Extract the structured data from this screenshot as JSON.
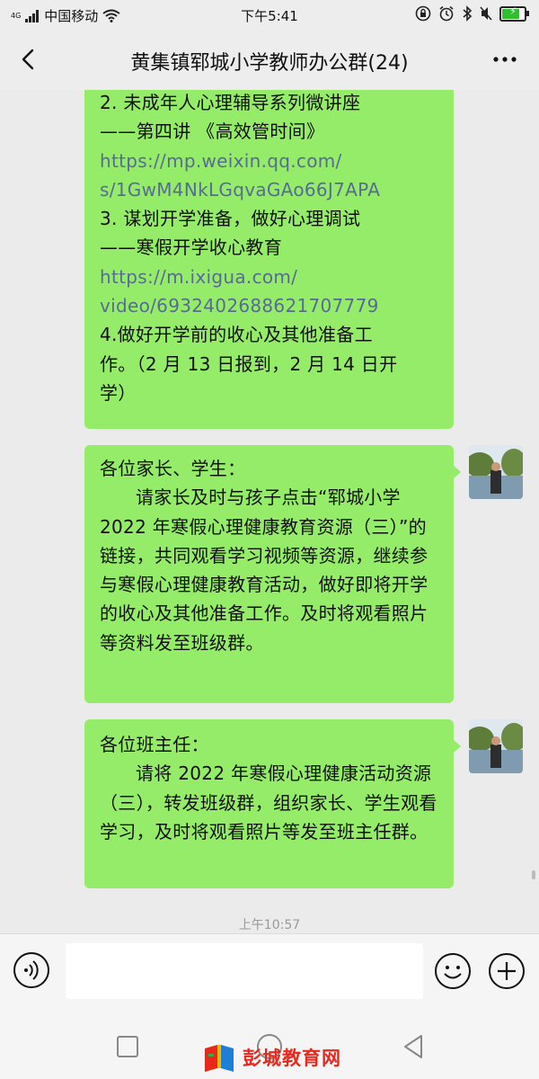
{
  "status_bar": {
    "network": "4G",
    "carrier": "中国移动",
    "time": "下午5:41",
    "battery_level": 0.85
  },
  "header": {
    "title": "黄集镇郓城小学教师办公群(24)"
  },
  "messages": [
    {
      "lines": [
        {
          "type": "text",
          "text": "2. 未成年人心理辅导系列微讲座"
        },
        {
          "type": "text",
          "text": "——第四讲 《高效管时间》"
        },
        {
          "type": "link",
          "text": "https://mp.weixin.qq.com/"
        },
        {
          "type": "link",
          "text": "s/1GwM4NkLGqvaGAo66J7APA"
        },
        {
          "type": "text",
          "text": "3. 谋划开学准备，做好心理调试"
        },
        {
          "type": "text",
          "text": "——寒假开学收心教育"
        },
        {
          "type": "link",
          "text": "https://m.ixigua.com/"
        },
        {
          "type": "link",
          "text": "video/6932402688621707779"
        },
        {
          "type": "text",
          "text": "4.做好开学前的收心及其他准备工"
        },
        {
          "type": "text",
          "text": "作。（2 月 13 日报到，2 月 14 日开"
        },
        {
          "type": "text",
          "text": "学）"
        }
      ]
    },
    {
      "greeting": "各位家长、学生：",
      "body": "请家长及时与孩子点击“郓城小学 2022 年寒假心理健康教育资源（三）”的链接，共同观看学习视频等资源，继续参与寒假心理健康教育活动，做好即将开学的收心及其他准备工作。及时将观看照片等资料发至班级群。"
    },
    {
      "greeting": "各位班主任：",
      "body": "请将 2022 年寒假心理健康活动资源（三），转发班级群，组织家长、学生观看学习，及时将观看照片等发至班主任群。"
    }
  ],
  "timestamp": "上午10:57",
  "watermark": {
    "text": "彭城教育网"
  },
  "colors": {
    "bubble": "#95ec69",
    "link": "#576b95",
    "background": "#ebebeb",
    "watermark": "#e8271d"
  }
}
